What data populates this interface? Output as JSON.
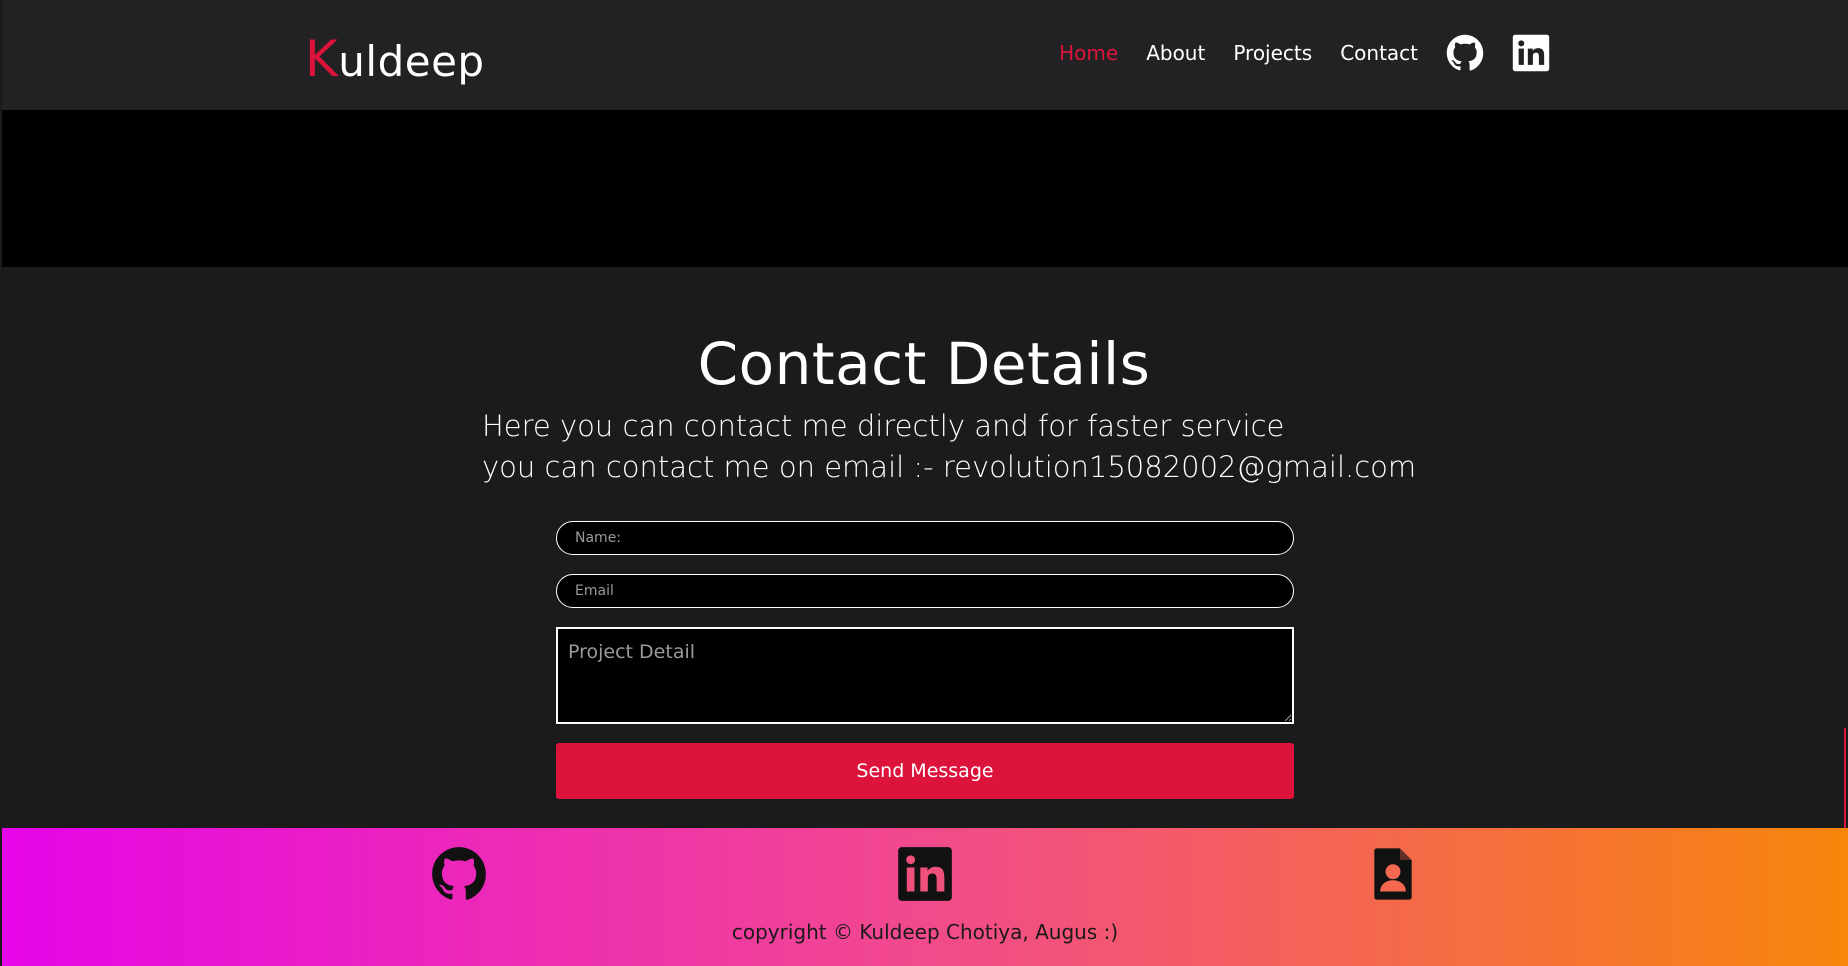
{
  "header": {
    "logo_first": "K",
    "logo_rest": "uldeep",
    "nav": [
      {
        "label": "Home"
      },
      {
        "label": "About"
      },
      {
        "label": "Projects"
      },
      {
        "label": "Contact"
      }
    ],
    "icons": [
      "github-icon",
      "linkedin-icon"
    ]
  },
  "contact": {
    "title": "Contact Details",
    "line1": "Here you can contact me directly and for faster service",
    "line2": "you can contact me on email :- revolution15082002@gmail.com",
    "name_placeholder": "Name:",
    "email_placeholder": "Email",
    "detail_placeholder": "Project Detail",
    "send_label": "Send Message"
  },
  "footer": {
    "icons": [
      "github-icon",
      "linkedin-icon",
      "resume-icon"
    ],
    "copyright": "copyright © Kuldeep Chotiya, Augus :)"
  },
  "colors": {
    "accent": "#dc143c",
    "header_bg": "#222123",
    "page_bg": "#1b1b1c",
    "footer_gradient": [
      "#e605e8",
      "#f24a8c",
      "#f7860b"
    ]
  }
}
